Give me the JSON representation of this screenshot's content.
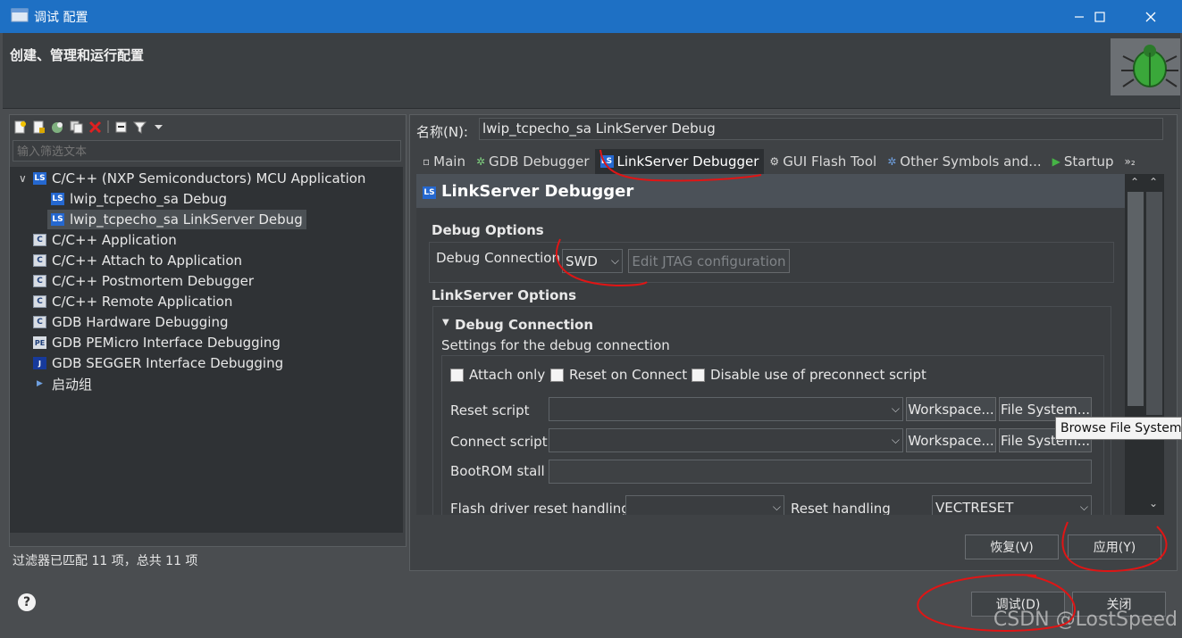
{
  "window": {
    "title": "调试 配置",
    "header_title": "创建、管理和运行配置"
  },
  "left": {
    "filter_placeholder": "输入筛选文本",
    "status": "过滤器已匹配 11 项，总共 11 项",
    "tree": [
      {
        "label": "C/C++ (NXP Semiconductors) MCU Application",
        "icon": "ls-icon"
      },
      {
        "label": "lwip_tcpecho_sa Debug",
        "icon": "ls-icon"
      },
      {
        "label": "lwip_tcpecho_sa LinkServer Debug",
        "icon": "ls-icon"
      },
      {
        "label": "C/C++ Application",
        "icon": "c-icon"
      },
      {
        "label": "C/C++ Attach to Application",
        "icon": "c-icon"
      },
      {
        "label": "C/C++ Postmortem Debugger",
        "icon": "c-icon"
      },
      {
        "label": "C/C++ Remote Application",
        "icon": "c-icon"
      },
      {
        "label": "GDB Hardware Debugging",
        "icon": "c-icon"
      },
      {
        "label": "GDB PEMicro Interface Debugging",
        "icon": "pe-icon"
      },
      {
        "label": "GDB SEGGER Interface Debugging",
        "icon": "jlink-icon"
      },
      {
        "label": "启动组",
        "icon": "launch-group-icon"
      }
    ]
  },
  "right": {
    "name_label": "名称(N):",
    "name_value": "lwip_tcpecho_sa LinkServer Debug",
    "tabs": [
      "Main",
      "GDB Debugger",
      "LinkServer Debugger",
      "GUI Flash Tool",
      "Other Symbols and...",
      "Startup"
    ],
    "tab_more": "»₂",
    "panel_title": "LinkServer Debugger",
    "debug_options": "Debug Options",
    "debug_connection_label": "Debug Connection",
    "debug_connection_value": "SWD",
    "edit_jtag": "Edit JTAG configuration",
    "linkserver_options": "LinkServer Options",
    "debug_connection_group": "Debug Connection",
    "debug_connection_desc": "Settings for the debug connection",
    "attach_only": "Attach only",
    "reset_on_connect": "Reset on Connect",
    "disable_preconnect": "Disable use of preconnect script",
    "reset_script": "Reset script",
    "connect_script": "Connect script",
    "workspace": "Workspace...",
    "file_system": "File System...",
    "bootrom_stall": "BootROM stall",
    "flash_driver_reset": "Flash driver reset handling",
    "reset_handling": "Reset handling",
    "reset_handling_value": "VECTRESET",
    "revert": "恢复(V)",
    "apply": "应用(Y)"
  },
  "footer": {
    "debug": "调试(D)",
    "close": "关闭"
  },
  "tooltip": "Browse File System",
  "watermark": "CSDN @LostSpeed"
}
